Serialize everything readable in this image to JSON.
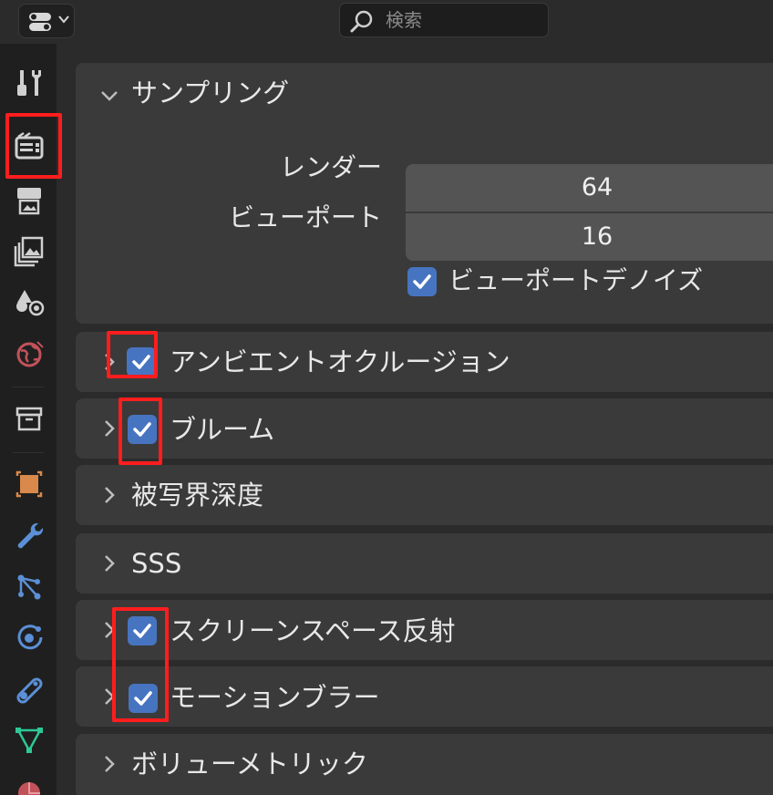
{
  "header": {
    "editor_type_icon": "properties-editor-icon",
    "search_placeholder": "検索"
  },
  "tabs": [
    {
      "name": "tool-properties-tab",
      "icon": "screwdriver-wrench-icon"
    },
    {
      "name": "render-properties-tab",
      "icon": "camera-back-icon",
      "active": true
    },
    {
      "name": "output-properties-tab",
      "icon": "printer-icon"
    },
    {
      "name": "view-layer-properties-tab",
      "icon": "image-stack-icon"
    },
    {
      "name": "scene-properties-tab",
      "icon": "scene-icon"
    },
    {
      "name": "world-properties-tab",
      "icon": "world-icon"
    },
    {
      "name": "collection-properties-tab",
      "icon": "collection-box-icon"
    },
    {
      "name": "object-properties-tab",
      "icon": "object-square-icon"
    },
    {
      "name": "modifier-properties-tab",
      "icon": "wrench-icon"
    },
    {
      "name": "particle-properties-tab",
      "icon": "particles-icon"
    },
    {
      "name": "physics-properties-tab",
      "icon": "physics-orbit-icon"
    },
    {
      "name": "constraint-properties-tab",
      "icon": "constraint-link-icon"
    },
    {
      "name": "data-properties-tab",
      "icon": "mesh-triangle-icon"
    },
    {
      "name": "material-properties-tab",
      "icon": "material-sphere-icon"
    }
  ],
  "sampling": {
    "title": "サンプリング",
    "render_label": "レンダー",
    "render_value": "64",
    "viewport_label": "ビューポート",
    "viewport_value": "16",
    "denoise_label": "ビューポートデノイズ",
    "denoise_checked": true
  },
  "panels": {
    "ambient_occlusion": {
      "title": "アンビエントオクルージョン",
      "checked": true
    },
    "bloom": {
      "title": "ブルーム",
      "checked": true
    },
    "depth_of_field": {
      "title": "被写界深度"
    },
    "sss": {
      "title": "SSS"
    },
    "ssr": {
      "title": "スクリーンスペース反射",
      "checked": true
    },
    "motion_blur": {
      "title": "モーションブラー",
      "checked": true
    },
    "volumetrics": {
      "title": "ボリューメトリック"
    }
  },
  "colors": {
    "checkbox": "#4774c0",
    "highlight": "#ff1d1d",
    "panel": "#3a3a3a",
    "field": "#545454"
  }
}
